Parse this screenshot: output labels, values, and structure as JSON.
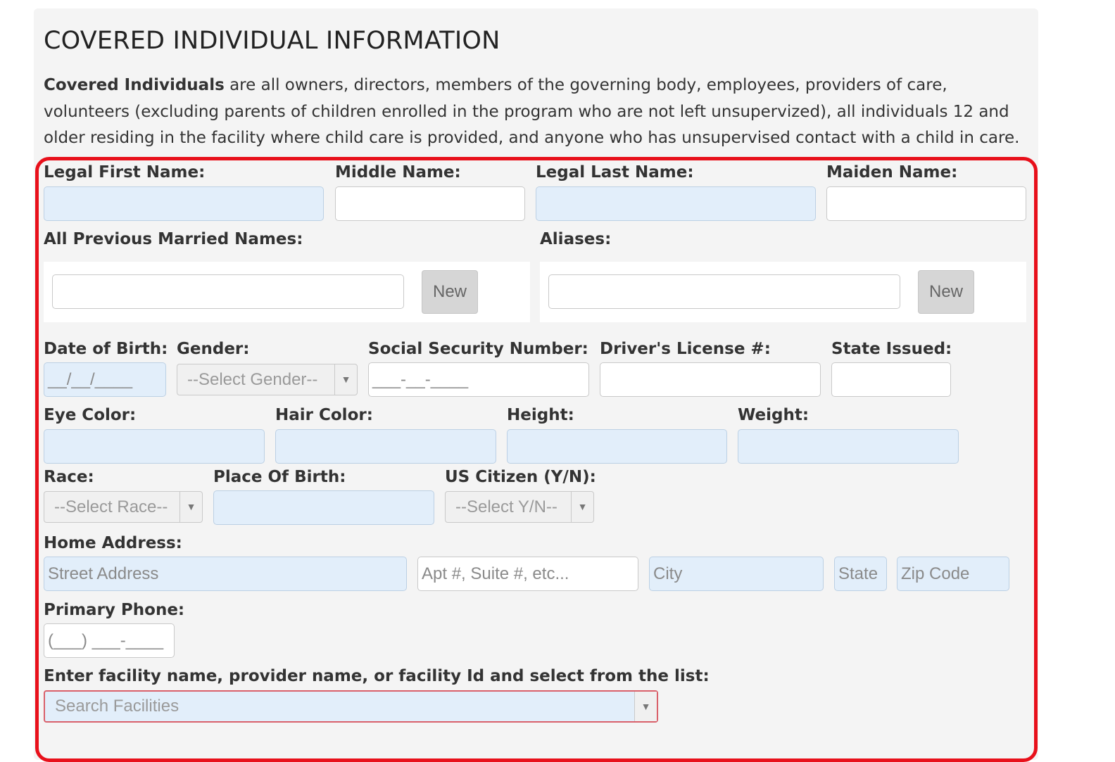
{
  "section": {
    "title": "COVERED INDIVIDUAL INFORMATION",
    "intro_bold": "Covered Individuals",
    "intro_text": " are all owners, directors, members of the governing body, employees, providers of care, volunteers (excluding parents of children enrolled in the program who are not left unsupervized), all individuals 12 and older residing in the facility where child care is provided, and anyone who has unsupervised contact with a child in care."
  },
  "names": {
    "first_label": "Legal First Name:",
    "middle_label": "Middle Name:",
    "last_label": "Legal Last Name:",
    "maiden_label": "Maiden Name:",
    "prev_married_label": "All Previous Married Names:",
    "aliases_label": "Aliases:",
    "new_button": "New"
  },
  "identity": {
    "dob_label": "Date of Birth:",
    "dob_mask": "__/__/____",
    "gender_label": "Gender:",
    "gender_select": "--Select Gender--",
    "ssn_label": "Social Security Number:",
    "ssn_mask": "___-__-____",
    "dl_label": "Driver's License #:",
    "state_issued_label": "State Issued:"
  },
  "physical": {
    "eye_label": "Eye Color:",
    "hair_label": "Hair Color:",
    "height_label": "Height:",
    "weight_label": "Weight:"
  },
  "demographics": {
    "race_label": "Race:",
    "race_select": "--Select Race--",
    "pob_label": "Place Of Birth:",
    "citizen_label": "US Citizen (Y/N):",
    "citizen_select": "--Select Y/N--"
  },
  "address": {
    "label": "Home Address:",
    "street_placeholder": "Street Address",
    "apt_placeholder": "Apt #, Suite #, etc...",
    "city_placeholder": "City",
    "state_placeholder": "State",
    "zip_placeholder": "Zip Code"
  },
  "phone": {
    "label": "Primary Phone:",
    "mask": "(___) ___-____"
  },
  "facility": {
    "label": "Enter facility name, provider name, or facility Id and select from the list:",
    "search_placeholder": "Search Facilities"
  },
  "colors": {
    "highlight_border": "#e8101b",
    "required_field_bg": "#e2eefa",
    "panel_bg": "#f4f4f4"
  },
  "icons": {
    "dropdown": "caret-down-icon"
  }
}
